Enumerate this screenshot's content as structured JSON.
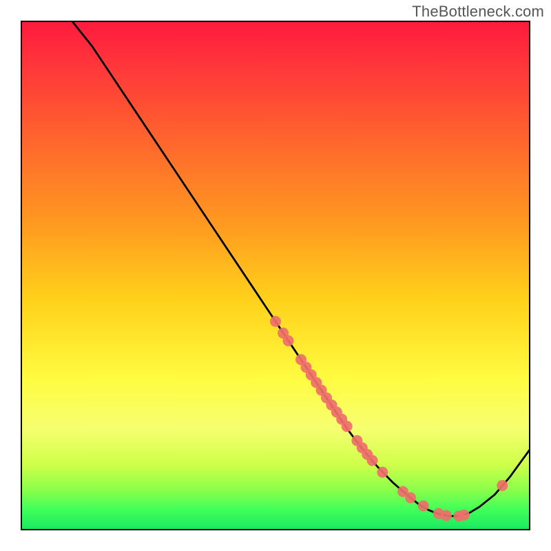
{
  "attribution": "TheBottleneck.com",
  "chart_data": {
    "type": "line",
    "title": "",
    "xlabel": "",
    "ylabel": "",
    "xlim": [
      0,
      100
    ],
    "ylim": [
      0,
      100
    ],
    "grid": false,
    "legend": false,
    "series": [
      {
        "name": "bottleneck-curve",
        "color": "#000000",
        "x": [
          10,
          14,
          18,
          22,
          26,
          30,
          34,
          38,
          42,
          46,
          50,
          52,
          55,
          58,
          61,
          64,
          67,
          70,
          73,
          76,
          78,
          80,
          82,
          84,
          86,
          88,
          90,
          93,
          96,
          100
        ],
        "y": [
          100,
          95,
          89,
          83,
          77,
          71,
          65,
          59,
          53,
          47,
          41,
          38,
          33.5,
          29,
          24.5,
          20,
          16,
          12.5,
          9.4,
          6.8,
          5.2,
          4.0,
          3.2,
          2.8,
          2.8,
          3.4,
          4.6,
          7.0,
          10.5,
          16
        ]
      }
    ],
    "scatter": [
      {
        "name": "marker-cluster",
        "color": "#ef6f6a",
        "radius": 8,
        "points": [
          {
            "x": 50,
            "y": 41
          },
          {
            "x": 51.5,
            "y": 38.7
          },
          {
            "x": 52.5,
            "y": 37.2
          },
          {
            "x": 55,
            "y": 33.5
          },
          {
            "x": 56,
            "y": 32
          },
          {
            "x": 57,
            "y": 30.5
          },
          {
            "x": 58,
            "y": 29
          },
          {
            "x": 59,
            "y": 27.5
          },
          {
            "x": 60,
            "y": 26
          },
          {
            "x": 61,
            "y": 24.6
          },
          {
            "x": 62,
            "y": 23.2
          },
          {
            "x": 63,
            "y": 21.8
          },
          {
            "x": 64,
            "y": 20.4
          },
          {
            "x": 66,
            "y": 17.6
          },
          {
            "x": 67,
            "y": 16.2
          },
          {
            "x": 68,
            "y": 14.9
          },
          {
            "x": 69,
            "y": 13.7
          },
          {
            "x": 71,
            "y": 11.4
          },
          {
            "x": 75,
            "y": 7.6
          },
          {
            "x": 76.5,
            "y": 6.4
          },
          {
            "x": 79,
            "y": 4.8
          },
          {
            "x": 82,
            "y": 3.3
          },
          {
            "x": 83.5,
            "y": 2.9
          },
          {
            "x": 86,
            "y": 2.8
          },
          {
            "x": 87,
            "y": 3.0
          },
          {
            "x": 94.5,
            "y": 8.8
          }
        ]
      }
    ],
    "gradient_stops": [
      {
        "pos": 0.0,
        "color": "#ff1a3e"
      },
      {
        "pos": 0.1,
        "color": "#ff3a3a"
      },
      {
        "pos": 0.25,
        "color": "#ff6a2c"
      },
      {
        "pos": 0.4,
        "color": "#ff9a20"
      },
      {
        "pos": 0.55,
        "color": "#ffd21a"
      },
      {
        "pos": 0.7,
        "color": "#fffb40"
      },
      {
        "pos": 0.8,
        "color": "#f6ff70"
      },
      {
        "pos": 0.87,
        "color": "#d0ff4a"
      },
      {
        "pos": 0.92,
        "color": "#8cff4a"
      },
      {
        "pos": 0.96,
        "color": "#3fff5a"
      },
      {
        "pos": 1.0,
        "color": "#18e860"
      }
    ]
  }
}
